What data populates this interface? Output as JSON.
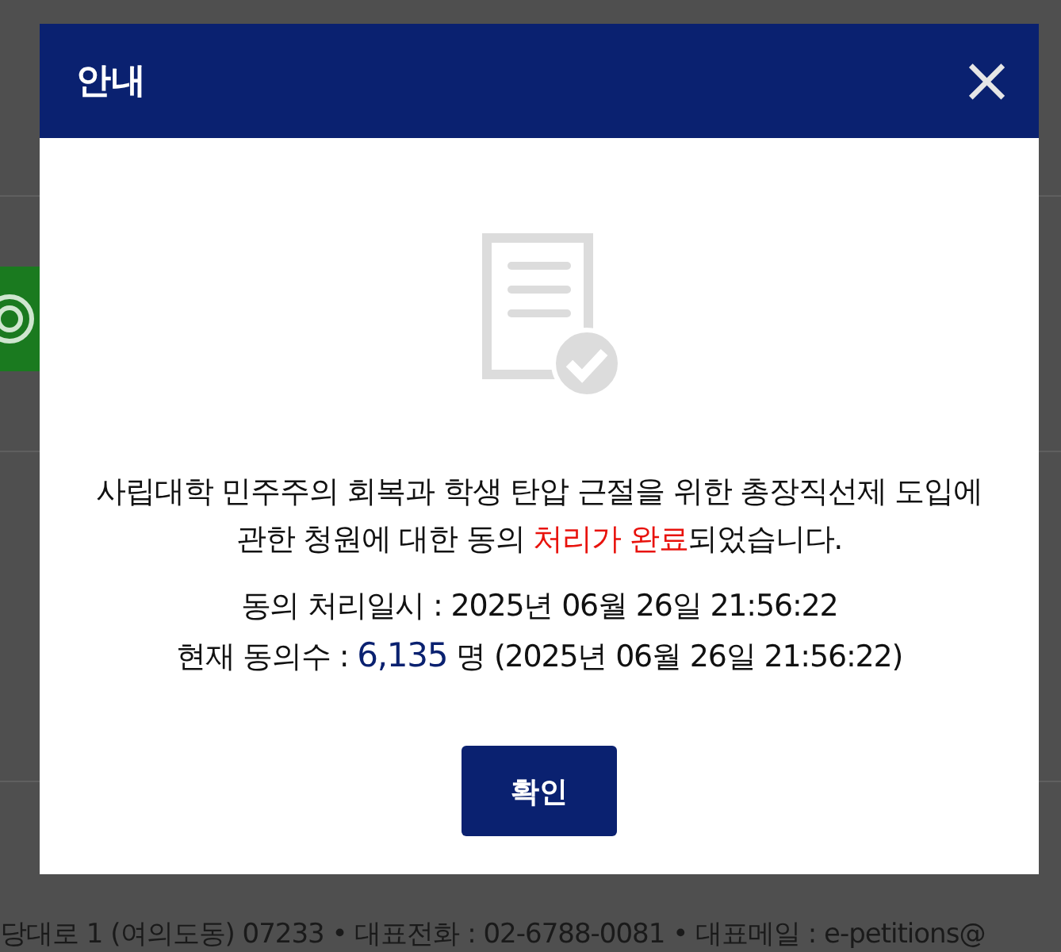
{
  "background_page": {
    "footer_address": "당대로 1 (여의도동) 07233 • 대표전화 : 02-6788-0081 • 대표메일 : e-petitions@"
  },
  "dialog": {
    "title": "안내",
    "close": "×",
    "message": "사립대학 민주주의 회복과 학생 탄압 근절을 위한 총장직선제 도입에 관한 청원에 대한 동의 **처리가 완료**되었습니다.",
    "processed_at": "동의 처리일시 : 2025년 06월 26일 21:56:22",
    "count_label": "현재 동의수 : ",
    "count": "6,135",
    "count_suffix": " 명 (2025년 06월 26일 21:56:22)",
    "button": "확인"
  }
}
